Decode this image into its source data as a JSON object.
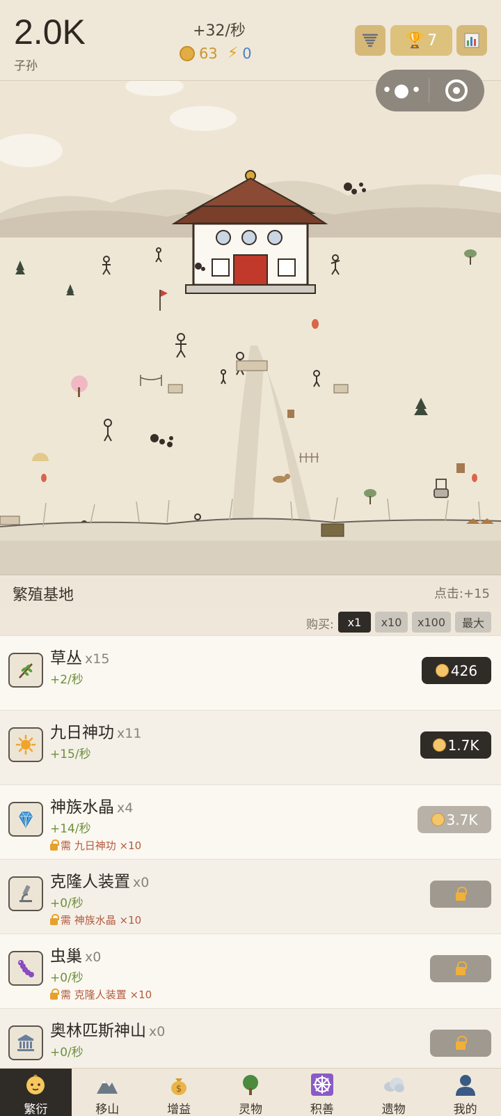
{
  "header": {
    "population": "2.0K",
    "population_label": "子孙",
    "rate": "+32/秒",
    "coins": "63",
    "energy": "0",
    "trophy": "7"
  },
  "scene": {
    "location_name": "繁殖基地",
    "click_bonus": "点击:+15"
  },
  "buy": {
    "label": "购买:",
    "options": [
      "x1",
      "x10",
      "x100",
      "最大"
    ],
    "selected": "x1"
  },
  "items": [
    {
      "name": "草丛",
      "count": "x15",
      "rate": "+2/秒",
      "requirement": "",
      "price": "426",
      "state": "available",
      "icon": "branch-icon"
    },
    {
      "name": "九日神功",
      "count": "x11",
      "rate": "+15/秒",
      "requirement": "",
      "price": "1.7K",
      "state": "available",
      "icon": "sun-icon"
    },
    {
      "name": "神族水晶",
      "count": "x4",
      "rate": "+14/秒",
      "requirement": "需 九日神功 ×10",
      "price": "3.7K",
      "state": "unaffordable",
      "icon": "gem-icon"
    },
    {
      "name": "克隆人装置",
      "count": "x0",
      "rate": "+0/秒",
      "requirement": "需 神族水晶 ×10",
      "price": "",
      "state": "locked",
      "icon": "microscope-icon"
    },
    {
      "name": "虫巢",
      "count": "x0",
      "rate": "+0/秒",
      "requirement": "需 克隆人装置 ×10",
      "price": "",
      "state": "locked",
      "icon": "worm-icon"
    },
    {
      "name": "奥林匹斯神山",
      "count": "x0",
      "rate": "+0/秒",
      "requirement": "",
      "price": "",
      "state": "locked",
      "icon": "temple-icon"
    }
  ],
  "tabs": [
    {
      "label": "繁衍",
      "icon": "baby-icon",
      "active": true
    },
    {
      "label": "移山",
      "icon": "mountain-icon",
      "active": false
    },
    {
      "label": "增益",
      "icon": "money-bag-icon",
      "active": false
    },
    {
      "label": "灵物",
      "icon": "tree-icon",
      "active": false
    },
    {
      "label": "积善",
      "icon": "dharma-wheel-icon",
      "active": false
    },
    {
      "label": "遗物",
      "icon": "cloud-icon",
      "active": false
    },
    {
      "label": "我的",
      "icon": "user-icon",
      "active": false
    }
  ],
  "colors": {
    "background": "#efe8da",
    "dark_button": "#2f2b27",
    "rate_green": "#6d8f3c",
    "requirement_red": "#b45a3e",
    "gold": "#d6b979"
  }
}
